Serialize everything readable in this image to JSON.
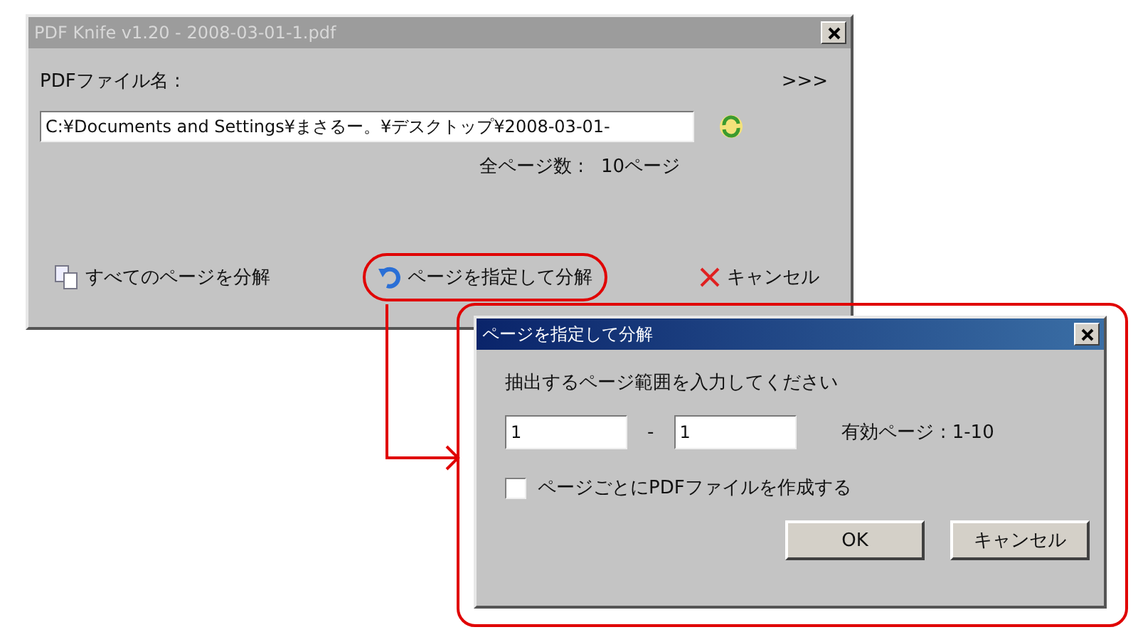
{
  "main_window": {
    "title": "PDF Knife v1.20 - 2008-03-01-1.pdf",
    "active": false,
    "file_label": "PDFファイル名 :",
    "expand_label": ">>>",
    "file_path": "C:¥Documents and Settings¥まさるー。¥デスクトップ¥2008-03-01-",
    "total_pages_label": "全ページ数 :",
    "total_pages": "10ページ",
    "buttons": [
      {
        "kind": "split-all",
        "label": "すべてのページを分解",
        "highlighted": false
      },
      {
        "kind": "split-range",
        "label": "ページを指定して分解",
        "highlighted": true
      },
      {
        "kind": "cancel",
        "label": "キャンセル",
        "highlighted": false
      }
    ]
  },
  "range_dialog": {
    "title": "ページを指定して分解",
    "active": true,
    "prompt": "抽出するページ範囲を入力してください",
    "from": "1",
    "separator": "-",
    "to": "1",
    "valid_pages": "有効ページ : 1-10",
    "per_page_option": {
      "label": "ページごとにPDFファイルを作成する",
      "checked": false
    },
    "buttons": [
      "OK",
      "キャンセル"
    ]
  }
}
